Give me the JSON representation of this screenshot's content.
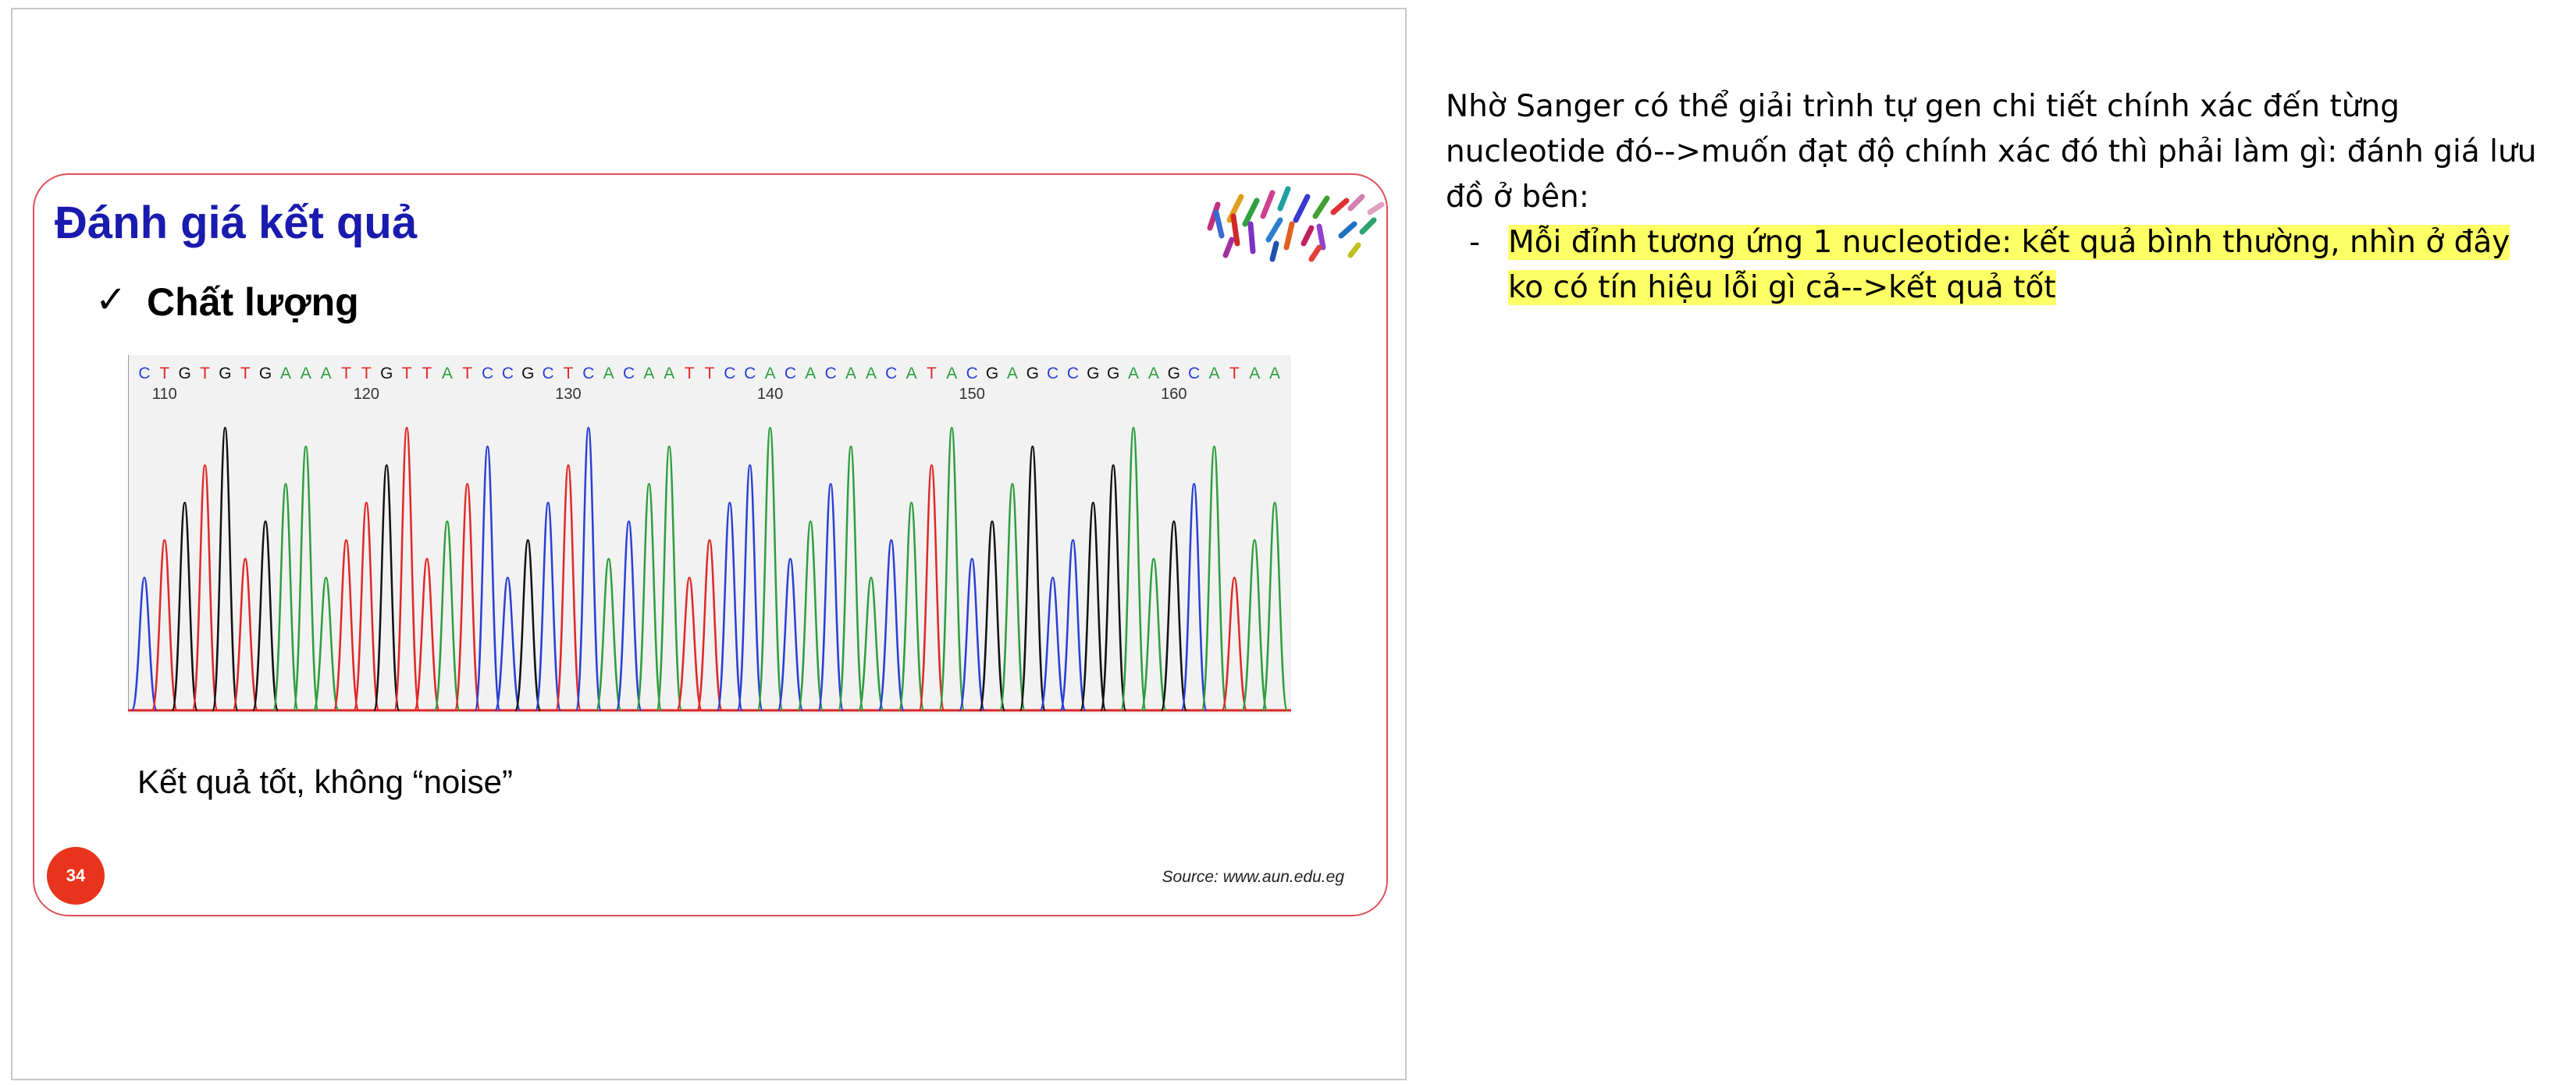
{
  "slide": {
    "title": "Đánh giá kết quả",
    "bullet": "Chất lượng",
    "check_symbol": "✓",
    "caption": "Kết quả tốt, không “noise”",
    "page_number": "34",
    "source": "Source: www.aun.edu.eg",
    "colors": {
      "title": "#1a1aae",
      "frame": "#e0505a",
      "page_badge": "#e8341c"
    }
  },
  "notes": {
    "paragraph": "Nhờ Sanger có thể giải trình tự gen chi tiết chính xác đến từng nucleotide đó-->muốn đạt độ chính xác đó thì phải làm gì: đánh giá lưu đồ ở bên:",
    "items": [
      {
        "marker": "-",
        "text": "Mỗi đỉnh tương ứng 1 nucleotide: kết quả bình thường, nhìn ở đây ko có tín hiệu lỗi gì cả-->kết quả tốt",
        "highlight": "#ffff66"
      }
    ]
  },
  "chromatogram": {
    "sequence": "CTGTGTGAAATTGTTATCCGCTCACAATTCCACACAACATACGAGCCGGAAGCATAA",
    "position_labels": [
      "110",
      "120",
      "130",
      "140",
      "150",
      "160"
    ],
    "base_colors": {
      "A": "#2e9e3e",
      "C": "#2a3fd6",
      "G": "#111111",
      "T": "#e02828"
    }
  }
}
